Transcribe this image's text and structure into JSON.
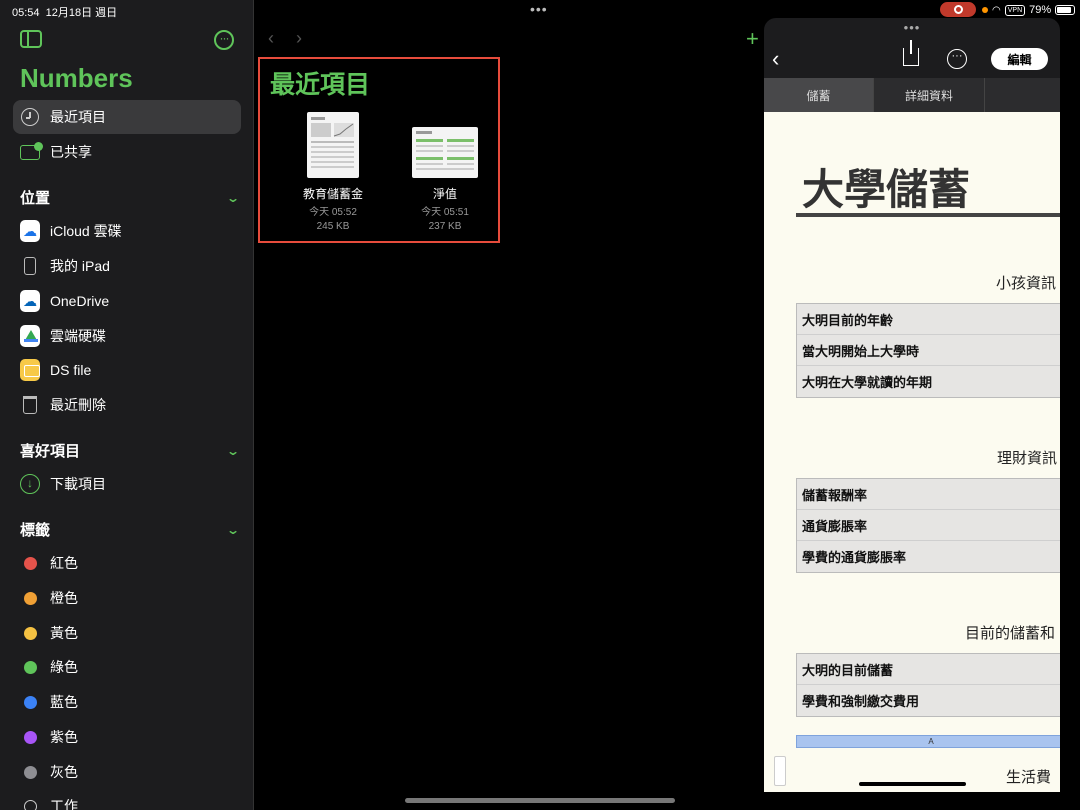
{
  "status": {
    "time": "05:54",
    "date": "12月18日 週日",
    "vpn": "VPN",
    "battery": "79%"
  },
  "sidebar": {
    "app_title": "Numbers",
    "nav": [
      {
        "label": "最近項目",
        "icon": "clock-icon",
        "active": true
      },
      {
        "label": "已共享",
        "icon": "shared-folder-icon",
        "active": false
      }
    ],
    "locations_title": "位置",
    "locations": [
      {
        "label": "iCloud 雲碟",
        "icon": "icloud-icon"
      },
      {
        "label": "我的 iPad",
        "icon": "ipad-icon"
      },
      {
        "label": "OneDrive",
        "icon": "onedrive-icon"
      },
      {
        "label": "雲端硬碟",
        "icon": "google-drive-icon"
      },
      {
        "label": "DS file",
        "icon": "ds-file-icon"
      },
      {
        "label": "最近刪除",
        "icon": "trash-icon"
      }
    ],
    "favorites_title": "喜好項目",
    "favorites": [
      {
        "label": "下載項目",
        "icon": "download-icon"
      }
    ],
    "tags_title": "標籤",
    "tags": [
      {
        "label": "紅色",
        "color": "#e5534b"
      },
      {
        "label": "橙色",
        "color": "#f0a035"
      },
      {
        "label": "黃色",
        "color": "#f5c142"
      },
      {
        "label": "綠色",
        "color": "#5fc45a"
      },
      {
        "label": "藍色",
        "color": "#3b82f6"
      },
      {
        "label": "紫色",
        "color": "#a855f7"
      },
      {
        "label": "灰色",
        "color": "#8e8e93"
      },
      {
        "label": "工作",
        "color": ""
      }
    ]
  },
  "main": {
    "recents_title": "最近項目",
    "documents": [
      {
        "name": "教育儲蓄金",
        "time": "今天 05:52",
        "size": "245 KB"
      },
      {
        "name": "淨值",
        "time": "今天 05:51",
        "size": "237 KB"
      }
    ]
  },
  "panel": {
    "edit_label": "編輯",
    "tabs": [
      {
        "label": "儲蓄",
        "active": true
      },
      {
        "label": "詳細資料",
        "active": false
      }
    ],
    "sheet_title": "大學儲蓄",
    "sections": [
      {
        "title": "小孩資訊",
        "rows": [
          "大明目前的年齡",
          "當大明開始上大學時",
          "大明在大學就讀的年期"
        ]
      },
      {
        "title": "理財資訊",
        "rows": [
          "儲蓄報酬率",
          "通貨膨脹率",
          "學費的通貨膨脹率"
        ]
      },
      {
        "title": "目前的儲蓄和",
        "rows": [
          "大明的目前儲蓄",
          "學費和強制繳交費用"
        ]
      }
    ],
    "column_label": "A",
    "last_section": "生活費"
  }
}
